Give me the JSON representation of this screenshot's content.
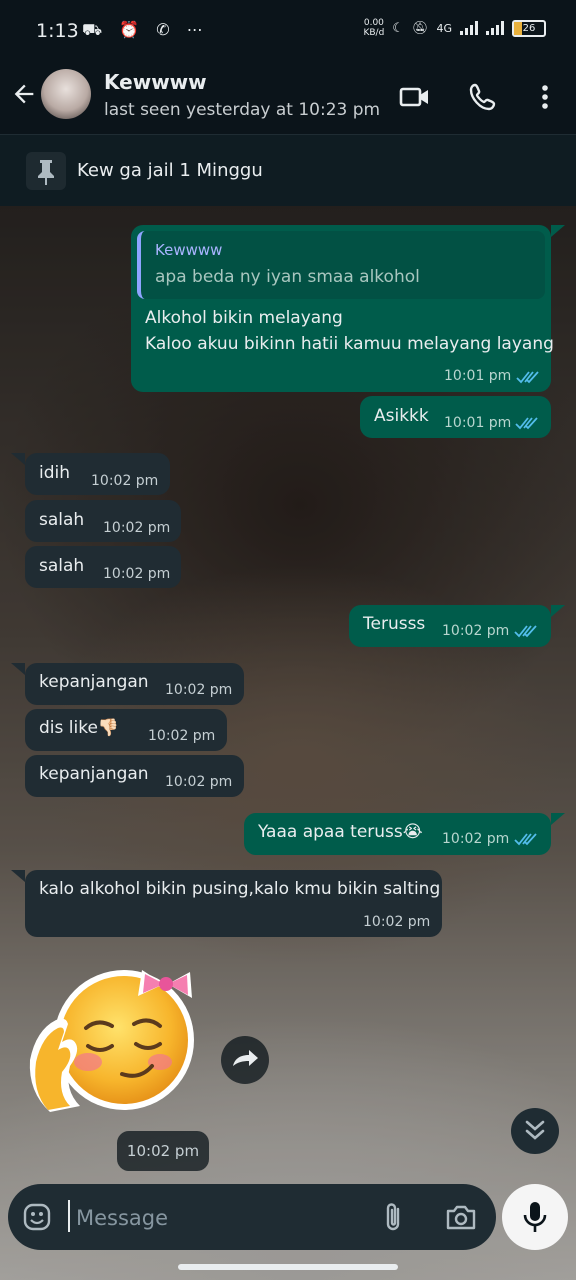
{
  "status_bar": {
    "time": "1:13",
    "left_icons": "⛟ ⏰ ✆ ⋯",
    "net_speed_top": "0.00",
    "net_speed_bottom": "KB/d",
    "network_type": "4G",
    "battery": "26"
  },
  "header": {
    "contact_name": "Kewwww",
    "last_seen": "last seen yesterday at 10:23 pm"
  },
  "pinned": {
    "text": "Kew ga jail 1 Minggu"
  },
  "messages": [
    {
      "direction": "out",
      "quote_name": "Kewwww",
      "quote_text": "apa beda ny iyan smaa alkohol",
      "line1": "Alkohol bikin melayang",
      "line2": "Kaloo akuu bikinn hatii kamuu melayang layang",
      "time": "10:01 pm",
      "read": true
    },
    {
      "direction": "out",
      "text": "Asikkk",
      "time": "10:01 pm",
      "read": true
    },
    {
      "direction": "in",
      "text": "idih",
      "time": "10:02 pm"
    },
    {
      "direction": "in",
      "text": "salah",
      "time": "10:02 pm"
    },
    {
      "direction": "in",
      "text": "salah",
      "time": "10:02 pm"
    },
    {
      "direction": "out",
      "text": "Terusss",
      "time": "10:02 pm",
      "read": true
    },
    {
      "direction": "in",
      "text": "kepanjangan",
      "time": "10:02 pm"
    },
    {
      "direction": "in",
      "text": "dis like👎🏻",
      "time": "10:02 pm"
    },
    {
      "direction": "in",
      "text": "kepanjangan",
      "time": "10:02 pm"
    },
    {
      "direction": "out",
      "text": "Yaaa apaa teruss😭",
      "time": "10:02 pm",
      "read": true
    },
    {
      "direction": "in",
      "text": "kalo alkohol bikin pusing,kalo kmu bikin salting",
      "time": "10:02 pm"
    },
    {
      "direction": "in",
      "type": "sticker",
      "sticker": "😌🎀",
      "time": "10:02 pm"
    }
  ],
  "composer": {
    "placeholder": "Message"
  },
  "colors": {
    "background": "#0b141a",
    "outgoing_bubble": "#005c4b",
    "incoming_bubble": "#202c33",
    "read_ticks": "#53bdeb"
  },
  "icons": [
    "back-arrow-icon",
    "video-call-icon",
    "voice-call-icon",
    "more-vert-icon",
    "pin-icon",
    "double-check-icon",
    "forward-icon",
    "chevron-double-down-icon",
    "emoji-icon",
    "attach-icon",
    "camera-icon",
    "mic-icon"
  ]
}
